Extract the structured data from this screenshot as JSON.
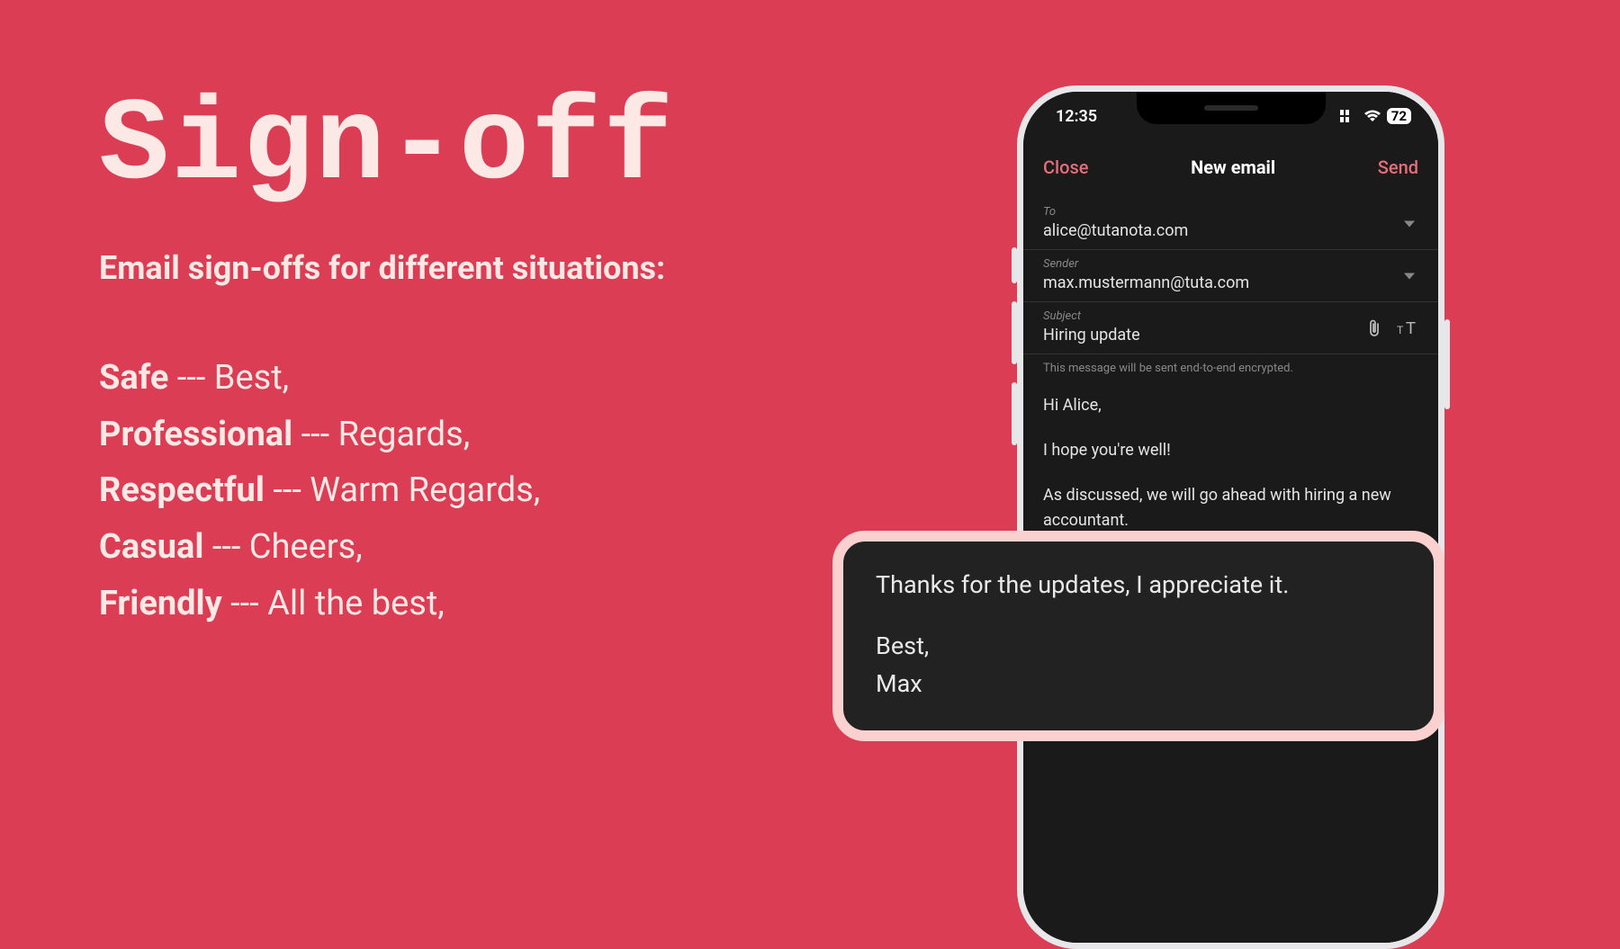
{
  "left": {
    "title": "Sign-off",
    "subtitle": "Email sign-offs for different situations:",
    "items": [
      {
        "label": "Safe",
        "value": "Best,"
      },
      {
        "label": "Professional",
        "value": "Regards,"
      },
      {
        "label": "Respectful",
        "value": "Warm Regards,"
      },
      {
        "label": "Casual",
        "value": "Cheers,"
      },
      {
        "label": "Friendly",
        "value": "All the best,"
      }
    ]
  },
  "phone": {
    "status": {
      "time": "12:35",
      "battery": "72"
    },
    "nav": {
      "close": "Close",
      "title": "New email",
      "send": "Send"
    },
    "fields": {
      "to": {
        "label": "To",
        "value": "alice@tutanota.com"
      },
      "sender": {
        "label": "Sender",
        "value": "max.mustermann@tuta.com"
      },
      "subject": {
        "label": "Subject",
        "value": "Hiring update"
      }
    },
    "encryption_note": "This message will be sent end-to-end encrypted.",
    "body": {
      "greeting": "Hi Alice,",
      "line1": "I hope you're well!",
      "line2": "As discussed, we will go ahead with hiring a new accountant."
    }
  },
  "callout": {
    "line1": "Thanks for the updates, I appreciate it.",
    "signoff": "Best,",
    "name": "Max"
  }
}
